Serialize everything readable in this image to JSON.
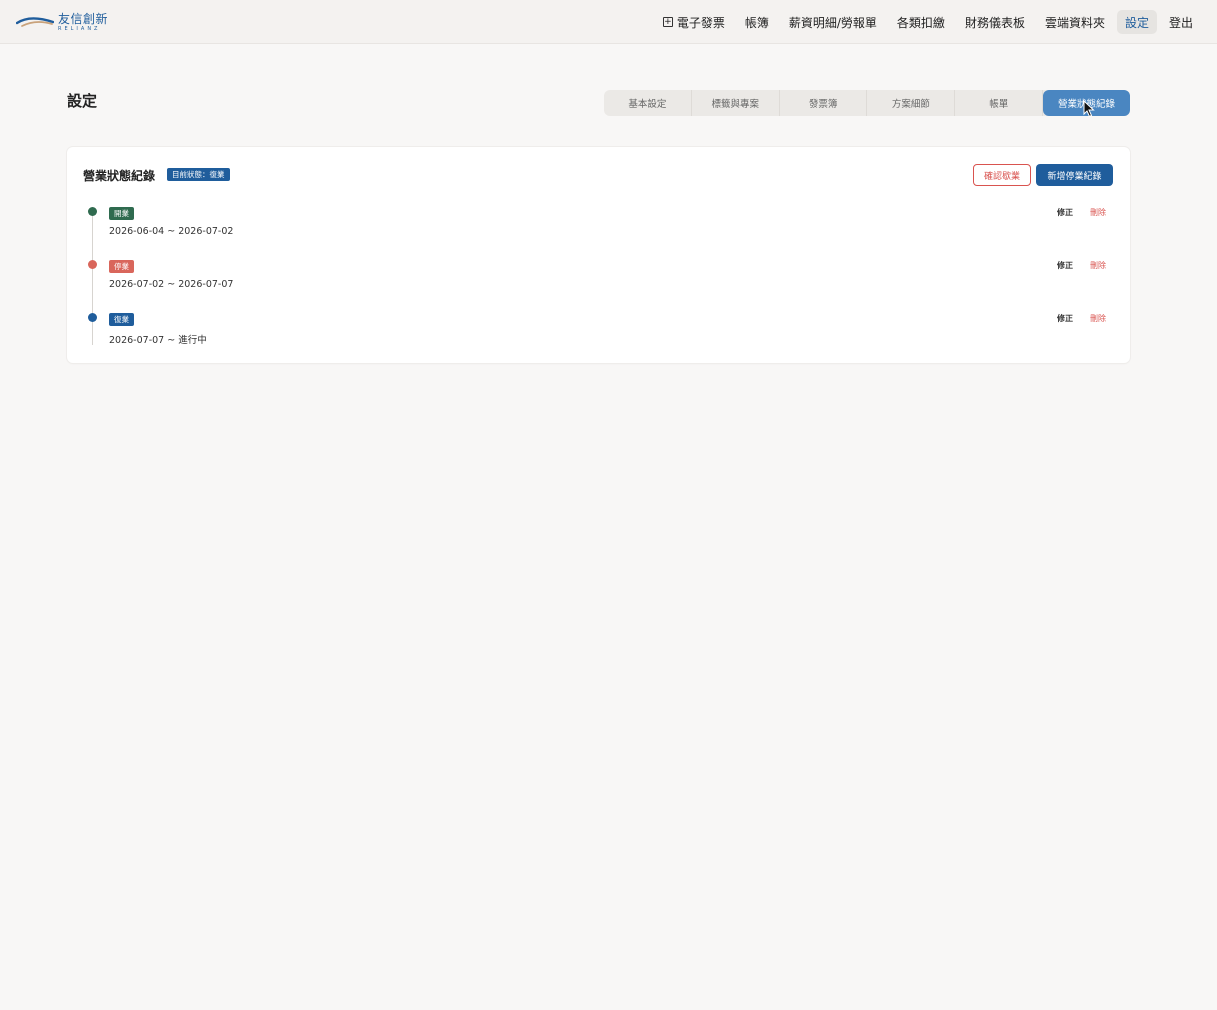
{
  "brand": {
    "name_zh": "友信創新",
    "name_en": "RELIANZ"
  },
  "nav": {
    "items": [
      {
        "label": "電子發票",
        "icon": "plus-box-icon",
        "active": false
      },
      {
        "label": "帳簿",
        "active": false
      },
      {
        "label": "薪資明細/勞報單",
        "active": false
      },
      {
        "label": "各類扣繳",
        "active": false
      },
      {
        "label": "財務儀表板",
        "active": false
      },
      {
        "label": "雲端資料夾",
        "active": false
      },
      {
        "label": "設定",
        "active": true
      },
      {
        "label": "登出",
        "active": false
      }
    ]
  },
  "page": {
    "title": "設定"
  },
  "tabs": [
    {
      "label": "基本設定",
      "active": false
    },
    {
      "label": "標籤與專案",
      "active": false
    },
    {
      "label": "發票簿",
      "active": false
    },
    {
      "label": "方案細節",
      "active": false
    },
    {
      "label": "帳單",
      "active": false
    },
    {
      "label": "營業狀態紀錄",
      "active": true
    }
  ],
  "card": {
    "title": "營業狀態紀錄",
    "current_status": "目前狀態：復業",
    "confirm_close_label": "確認歇業",
    "add_suspension_label": "新增停業紀錄"
  },
  "records": [
    {
      "status": "開業",
      "range": "2026-06-04 ~ 2026-07-02",
      "edit_label": "修正",
      "delete_label": "刪除",
      "color": "#2f6b4f"
    },
    {
      "status": "停業",
      "range": "2026-07-02 ~ 2026-07-07",
      "edit_label": "修正",
      "delete_label": "刪除",
      "color": "#d9665b"
    },
    {
      "status": "復業",
      "range": "2026-07-07 ~ 進行中",
      "edit_label": "修正",
      "delete_label": "刪除",
      "color": "#1f5d9c"
    }
  ],
  "colors": {
    "brand_blue": "#1f5d9c",
    "tab_active": "#4a86c1",
    "danger": "#d9534f",
    "background": "#f8f7f6"
  }
}
